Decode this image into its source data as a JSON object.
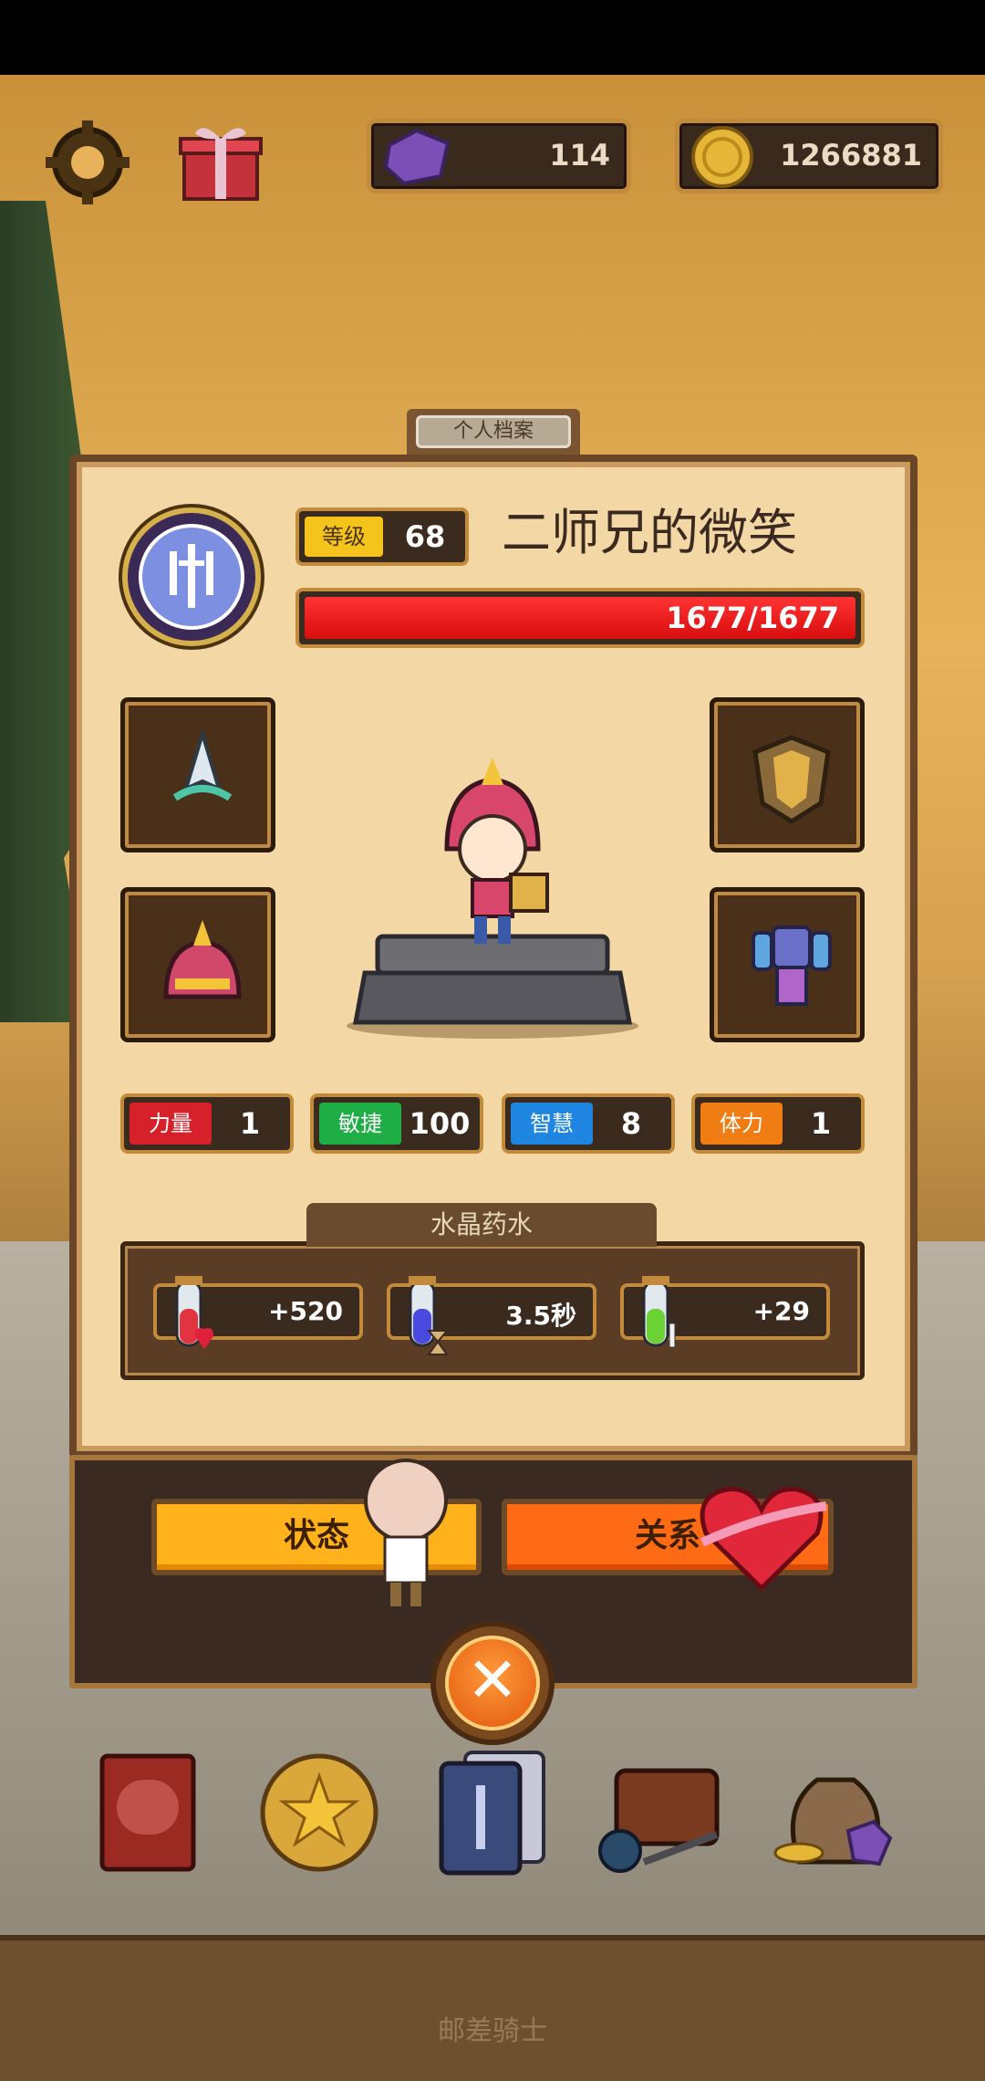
{
  "header": {
    "gems": "114",
    "coins": "1266881"
  },
  "panel": {
    "tab_title": "个人档案",
    "level_label": "等级",
    "level_value": "68",
    "player_name": "二师兄的微笑",
    "hp_text": "1677/1677",
    "hp_fraction": 1.0
  },
  "stats": [
    {
      "label": "力量",
      "value": "1",
      "color": "#d6212b"
    },
    {
      "label": "敏捷",
      "value": "100",
      "color": "#1fae45"
    },
    {
      "label": "智慧",
      "value": "8",
      "color": "#1e86e0"
    },
    {
      "label": "体力",
      "value": "1",
      "color": "#f07d14"
    }
  ],
  "potions": {
    "title": "水晶药水",
    "items": [
      {
        "value": "+520",
        "icon": "heart-potion-icon"
      },
      {
        "value": "3.5秒",
        "icon": "hourglass-potion-icon"
      },
      {
        "value": "+29",
        "icon": "sword-potion-icon"
      }
    ]
  },
  "buttons": {
    "status": "状态",
    "relation": "关系",
    "close": "✕"
  },
  "footer": {
    "title": "邮差骑士"
  }
}
